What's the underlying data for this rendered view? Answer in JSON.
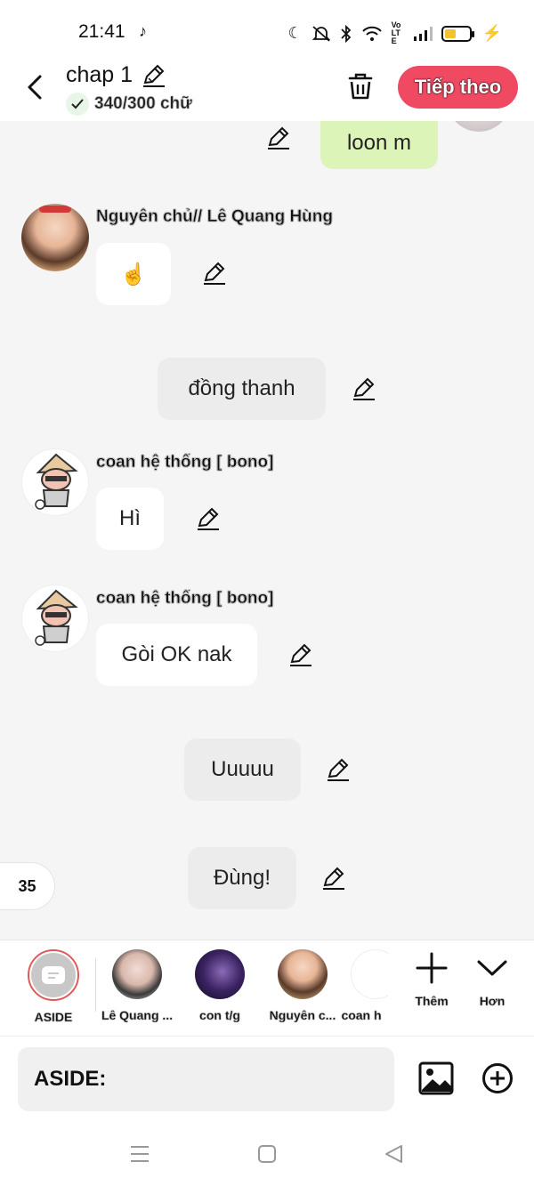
{
  "status": {
    "time": "21:41",
    "network_label": "VoLTE"
  },
  "header": {
    "title": "chap 1",
    "word_count": "340/300 chữ",
    "next_label": "Tiếp theo"
  },
  "messages": [
    {
      "type": "right",
      "text": "loon m"
    },
    {
      "type": "left",
      "sender": "Nguyên chủ// Lê Quang Hùng",
      "text": "☝️"
    },
    {
      "type": "center",
      "text": "đồng thanh"
    },
    {
      "type": "left",
      "sender": "coan hệ thống [ bono]",
      "text": "Hì"
    },
    {
      "type": "left",
      "sender": "coan hệ thống [ bono]",
      "text": "Gòi OK nak"
    },
    {
      "type": "center",
      "text": "Uuuuu"
    },
    {
      "type": "center",
      "text": "Đùng!"
    }
  ],
  "page_badge": "35",
  "characters": [
    {
      "label": "ASIDE"
    },
    {
      "label": "Lê Quang ..."
    },
    {
      "label": "con t/g"
    },
    {
      "label": "Nguyên c..."
    },
    {
      "label": "coan h"
    }
  ],
  "tools": {
    "add_label": "Thêm",
    "more_label": "Hơn"
  },
  "input": {
    "placeholder": "ASIDE:"
  },
  "colors": {
    "accent": "#ef4a62",
    "right_bubble": "#dcf4b8",
    "center_bubble": "#ececec",
    "left_bubble": "#ffffff"
  }
}
